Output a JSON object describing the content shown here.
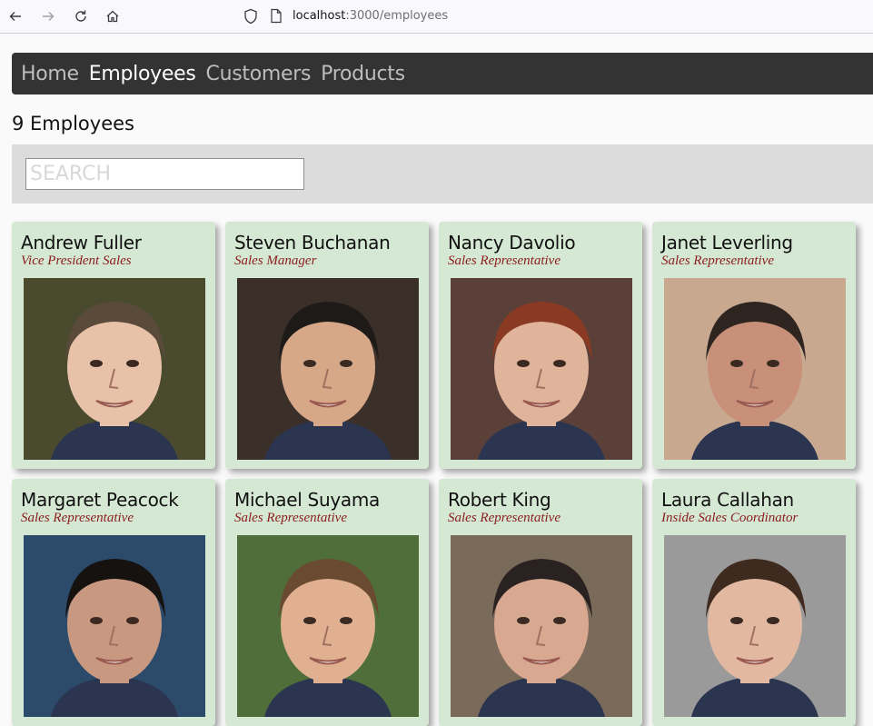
{
  "browser": {
    "url_host": "localhost",
    "url_path": ":3000/employees",
    "icons": [
      "back-icon",
      "forward-icon",
      "reload-icon",
      "home-icon",
      "shield-icon",
      "page-icon"
    ]
  },
  "nav": {
    "items": [
      {
        "label": "Home"
      },
      {
        "label": "Employees"
      },
      {
        "label": "Customers"
      },
      {
        "label": "Products"
      }
    ],
    "active": "Employees"
  },
  "main": {
    "count_heading": "9 Employees",
    "search_placeholder": "SEARCH",
    "search_value": ""
  },
  "employees": [
    {
      "name": "Andrew Fuller",
      "title": "Vice President Sales",
      "bg": "#4a4a2e",
      "skin": "#e8c2a8",
      "hair": "#5a4a3a"
    },
    {
      "name": "Steven Buchanan",
      "title": "Sales Manager",
      "bg": "#3b2f2a",
      "skin": "#d7a888",
      "hair": "#1e1a18"
    },
    {
      "name": "Nancy Davolio",
      "title": "Sales Representative",
      "bg": "#5a4038",
      "skin": "#e0b49a",
      "hair": "#8a3a22"
    },
    {
      "name": "Janet Leverling",
      "title": "Sales Representative",
      "bg": "#c9a890",
      "skin": "#c89078",
      "hair": "#2e2420"
    },
    {
      "name": "Margaret Peacock",
      "title": "Sales Representative",
      "bg": "#2c4a6a",
      "skin": "#c89880",
      "hair": "#151210"
    },
    {
      "name": "Michael Suyama",
      "title": "Sales Representative",
      "bg": "#4f6e3a",
      "skin": "#e0b090",
      "hair": "#6a4a30"
    },
    {
      "name": "Robert King",
      "title": "Sales Representative",
      "bg": "#7a6a5a",
      "skin": "#d8a890",
      "hair": "#2a2220"
    },
    {
      "name": "Laura Callahan",
      "title": "Inside Sales Coordinator",
      "bg": "#9a9a9a",
      "skin": "#e2b8a0",
      "hair": "#3e2a1e"
    }
  ]
}
